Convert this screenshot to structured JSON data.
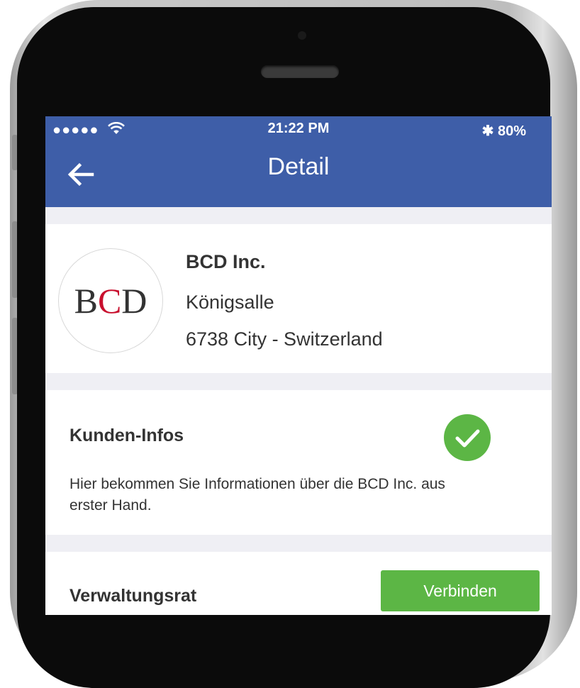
{
  "status_bar": {
    "signal": "●●●●●",
    "time": "21:22 PM",
    "bluetooth": "✱",
    "battery": "80%"
  },
  "nav": {
    "title": "Detail",
    "back_icon": "arrow-left-icon"
  },
  "company": {
    "logo": {
      "text_left": "B",
      "text_mid": "C",
      "text_right": "D",
      "accent": "#c8102e"
    },
    "name": "BCD Inc.",
    "street": "Königsalle",
    "city": "6738 City - Switzerland"
  },
  "customer_info": {
    "title": "Kunden-Infos",
    "status_icon": "check-icon",
    "description": "Hier bekommen Sie Informationen über die BCD Inc. aus erster Hand."
  },
  "board": {
    "title": "Verwaltungsrat",
    "connect_label": "Verbinden"
  },
  "colors": {
    "header": "#3e5ea8",
    "success": "#5cb645",
    "background": "#efeff4"
  }
}
